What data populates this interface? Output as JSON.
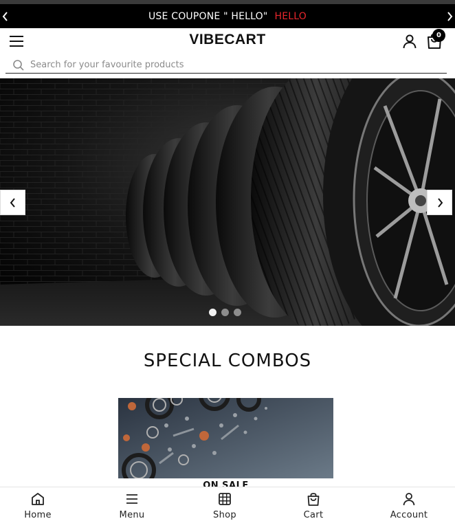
{
  "announcement": {
    "text": "USE COUPONE \" HELLO\"",
    "highlight": "HELLO",
    "highlight_color": "#e8262c",
    "prev_icon": "chevron-left-icon",
    "next_icon": "chevron-right-icon"
  },
  "header": {
    "brand": "VIBECART",
    "menu_icon": "hamburger-icon",
    "account_icon": "user-icon",
    "cart_icon": "shopping-bag-icon",
    "cart_count": "0"
  },
  "search": {
    "placeholder": "Search for your favourite products",
    "icon": "search-icon"
  },
  "hero": {
    "slide_count": 3,
    "active_slide": 1,
    "prev_icon": "chevron-left-icon",
    "next_icon": "chevron-right-icon"
  },
  "sections": {
    "combos_title": "SPECIAL COMBOS",
    "combo_card_label": "ON SALE"
  },
  "bottom_nav": {
    "items": [
      {
        "label": "Home",
        "icon": "home-icon"
      },
      {
        "label": "Menu",
        "icon": "menu-icon"
      },
      {
        "label": "Shop",
        "icon": "grid-icon"
      },
      {
        "label": "Cart",
        "icon": "shopping-bag-icon"
      },
      {
        "label": "Account",
        "icon": "user-icon"
      }
    ]
  }
}
